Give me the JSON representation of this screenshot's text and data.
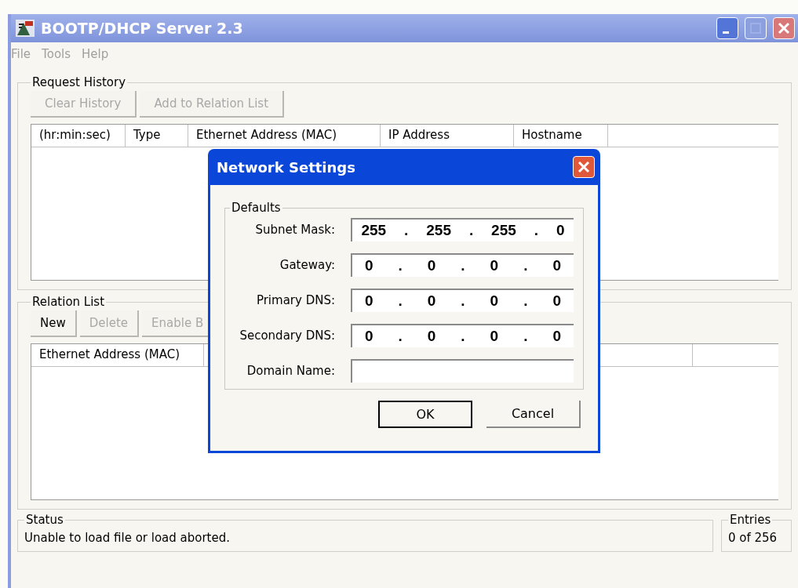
{
  "window": {
    "title": "BOOTP/DHCP Server 2.3",
    "active": false
  },
  "menu": [
    {
      "label": "File",
      "disabled": true
    },
    {
      "label": "Tools",
      "disabled": true
    },
    {
      "label": "Help",
      "disabled": true
    }
  ],
  "request_history": {
    "title": "Request History",
    "buttons": [
      {
        "label": "Clear History",
        "disabled": true
      },
      {
        "label": "Add to Relation List",
        "disabled": true
      }
    ],
    "columns": [
      "(hr:min:sec)",
      "Type",
      "Ethernet Address (MAC)",
      "IP Address",
      "Hostname"
    ]
  },
  "relation_list": {
    "title": "Relation List",
    "buttons": [
      {
        "label": "New",
        "disabled": false
      },
      {
        "label": "Delete",
        "disabled": true
      },
      {
        "label": "Enable B",
        "disabled": true
      }
    ],
    "columns": [
      "Ethernet Address (MAC)"
    ]
  },
  "status": {
    "title": "Status",
    "text": "Unable to load file or load aborted."
  },
  "entries": {
    "title": "Entries",
    "text": "0 of 256"
  },
  "dialog": {
    "title": "Network Settings",
    "group": "Defaults",
    "fields": [
      {
        "kind": "ip",
        "label": "Subnet Mask:",
        "octets": [
          "255",
          "255",
          "255",
          "0"
        ],
        "separator": "."
      },
      {
        "kind": "ip",
        "label": "Gateway:",
        "octets": [
          "0",
          "0",
          "0",
          "0"
        ],
        "separator": "."
      },
      {
        "kind": "ip",
        "label": "Primary DNS:",
        "octets": [
          "0",
          "0",
          "0",
          "0"
        ],
        "separator": "."
      },
      {
        "kind": "ip",
        "label": "Secondary DNS:",
        "octets": [
          "0",
          "0",
          "0",
          "0"
        ],
        "separator": "."
      },
      {
        "kind": "text",
        "label": "Domain Name:"
      }
    ],
    "buttons": [
      {
        "label": "OK",
        "default": true
      },
      {
        "label": "Cancel",
        "default": false
      }
    ]
  }
}
